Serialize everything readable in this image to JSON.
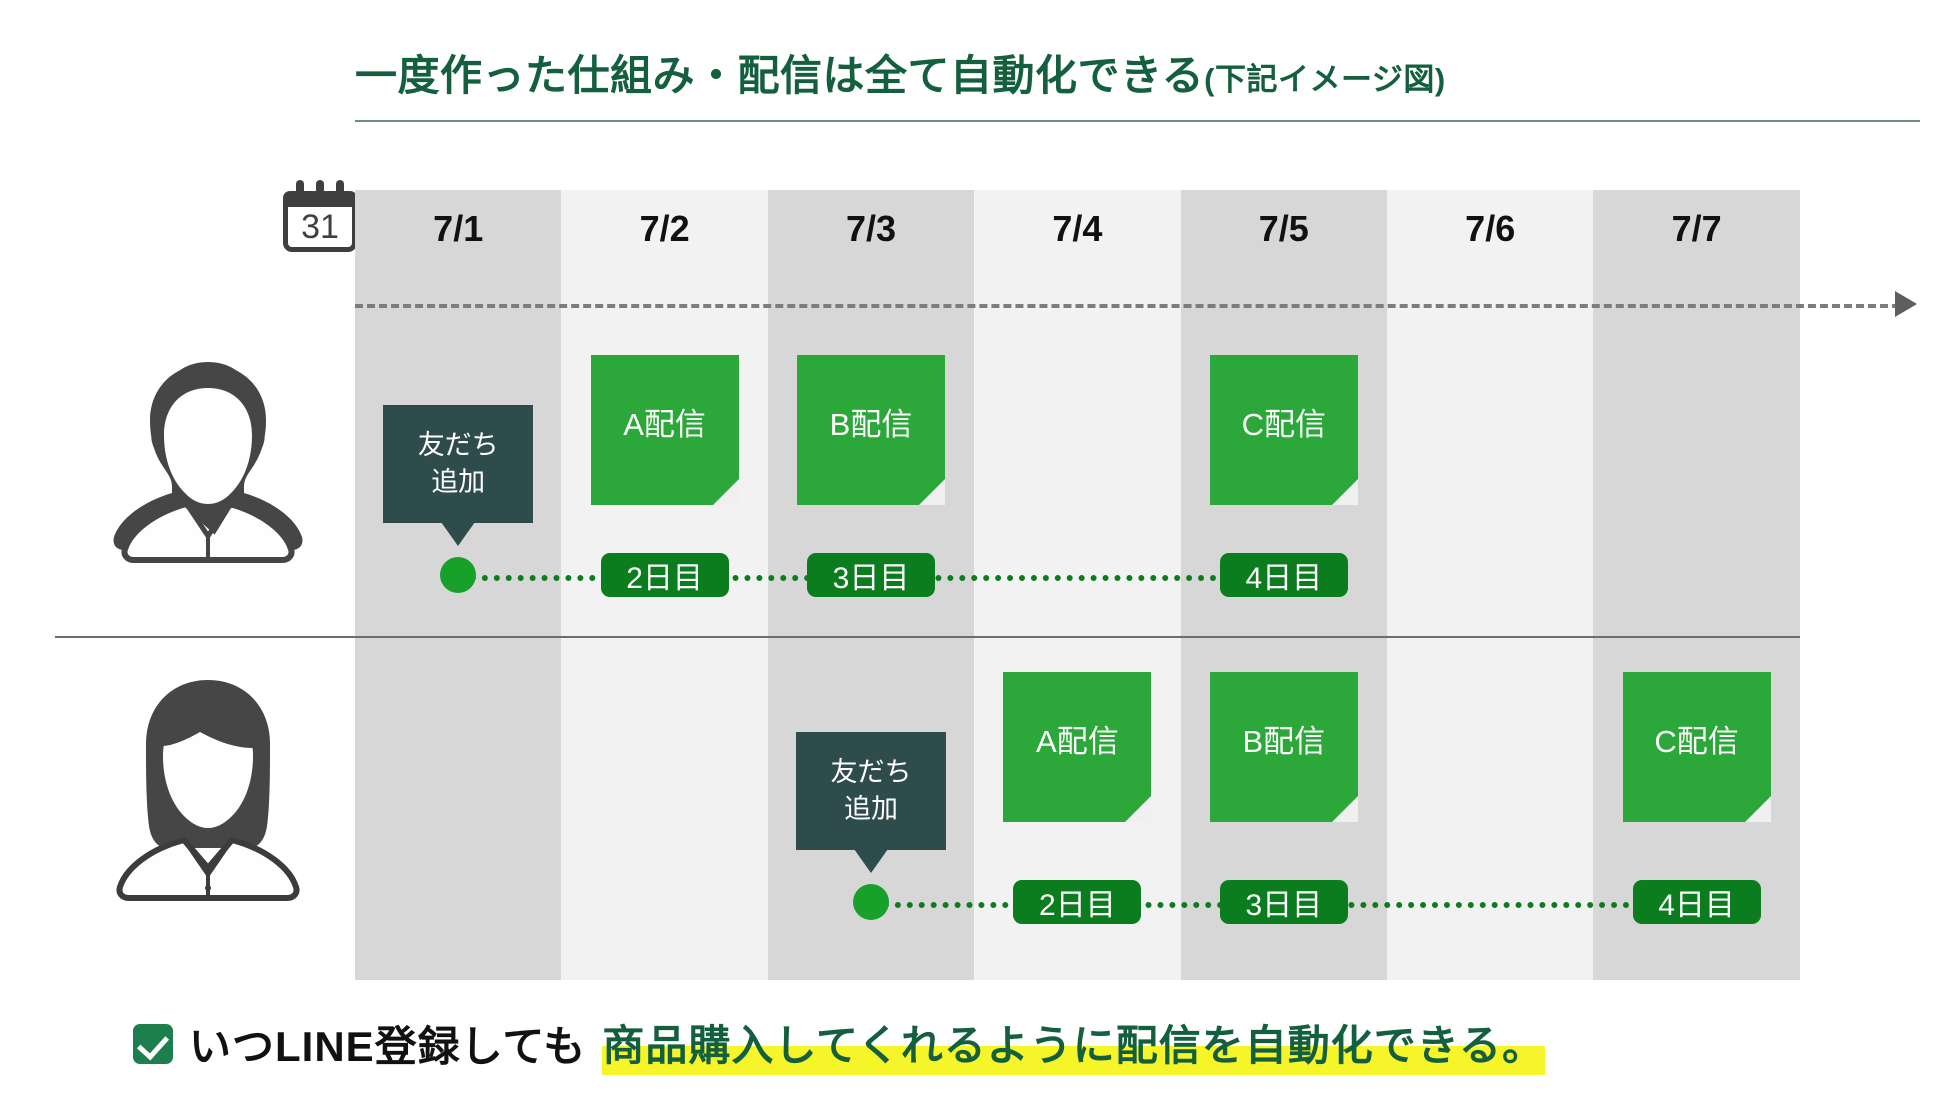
{
  "title": {
    "main": "一度作った仕組み・配信は全て自動化できる",
    "suffix": "(下記イメージ図)"
  },
  "calendar_icon": {
    "day": "31",
    "name": "calendar-icon"
  },
  "timeline": {
    "columns": [
      {
        "label": "7/1",
        "shade": "dark"
      },
      {
        "label": "7/2",
        "shade": "light"
      },
      {
        "label": "7/3",
        "shade": "dark"
      },
      {
        "label": "7/4",
        "shade": "light"
      },
      {
        "label": "7/5",
        "shade": "dark"
      },
      {
        "label": "7/6",
        "shade": "light"
      },
      {
        "label": "7/7",
        "shade": "dark"
      }
    ],
    "arrow": "timeline-arrow-right"
  },
  "rows": [
    {
      "avatar": "male-avatar",
      "signup": {
        "label_line1": "友だち",
        "label_line2": "追加",
        "column": "7/1"
      },
      "cards": [
        {
          "label": "A配信",
          "column": "7/2"
        },
        {
          "label": "B配信",
          "column": "7/3"
        },
        {
          "label": "C配信",
          "column": "7/5"
        }
      ],
      "badges": [
        {
          "label": "2日目",
          "column": "7/2"
        },
        {
          "label": "3日目",
          "column": "7/3"
        },
        {
          "label": "4日目",
          "column": "7/5"
        }
      ]
    },
    {
      "avatar": "female-avatar",
      "signup": {
        "label_line1": "友だち",
        "label_line2": "追加",
        "column": "7/3"
      },
      "cards": [
        {
          "label": "A配信",
          "column": "7/4"
        },
        {
          "label": "B配信",
          "column": "7/5"
        },
        {
          "label": "C配信",
          "column": "7/7"
        }
      ],
      "badges": [
        {
          "label": "2日目",
          "column": "7/4"
        },
        {
          "label": "3日目",
          "column": "7/5"
        },
        {
          "label": "4日目",
          "column": "7/7"
        }
      ]
    }
  ],
  "caption": {
    "plain": "いつLINE登録しても",
    "highlight": "商品購入してくれるように配信を自動化できる。"
  },
  "colors": {
    "title_green": "#14603E",
    "card_green": "#2CA83A",
    "badge_green": "#0B7D1E",
    "dot_green": "#17A12A",
    "tooltip_teal": "#2F4C4C",
    "column_dark": "#D7D7D7",
    "column_light": "#F2F2F2",
    "highlight_yellow": "#F5F52A",
    "avatar_gray": "#464646"
  }
}
